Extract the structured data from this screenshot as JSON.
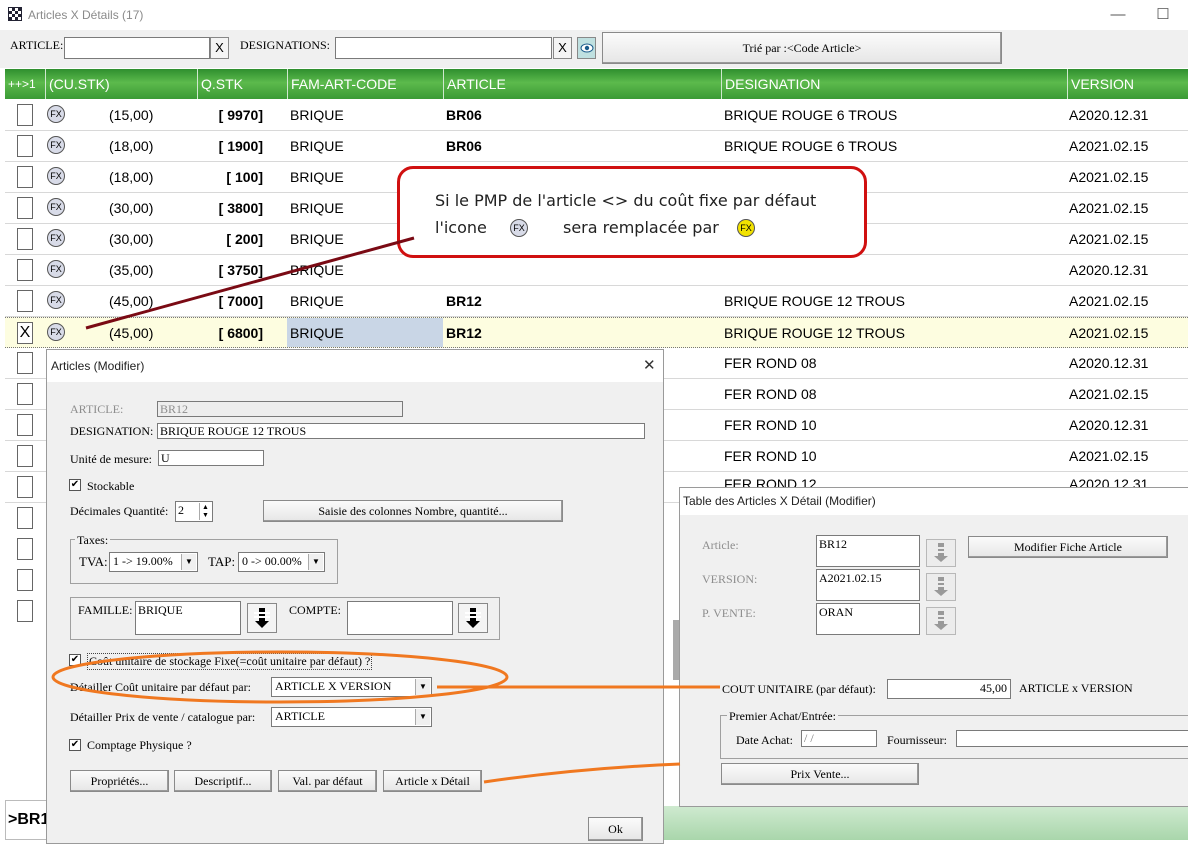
{
  "window": {
    "title": "Articles X Détails (17)",
    "minimize": "—",
    "maximize": "☐"
  },
  "toolbar": {
    "article_label": "ARTICLE:",
    "article_value": "",
    "designations_label": "DESIGNATIONS:",
    "designations_value": "",
    "clear_label": "X",
    "sort_label": "Trié par :<Code Article>"
  },
  "grid": {
    "columns": [
      "++>1",
      "(CU.STK)",
      "Q.STK",
      "FAM-ART-CODE",
      "ARTICLE",
      "DESIGNATION",
      "VERSION"
    ],
    "fx_label": "FX",
    "rows": [
      {
        "check": "",
        "cu": "(15,00)",
        "q": "[ 9970]",
        "fam": "BRIQUE",
        "article": "BR06",
        "designation": "BRIQUE ROUGE 6 TROUS",
        "version": "A2020.12.31"
      },
      {
        "check": "",
        "cu": "(18,00)",
        "q": "[ 1900]",
        "fam": "BRIQUE",
        "article": "BR06",
        "designation": "BRIQUE ROUGE 6 TROUS",
        "version": "A2021.02.15"
      },
      {
        "check": "",
        "cu": "(18,00)",
        "q": "[ 100]",
        "fam": "BRIQUE",
        "article": "",
        "designation": "",
        "version": "A2021.02.15"
      },
      {
        "check": "",
        "cu": "(30,00)",
        "q": "[ 3800]",
        "fam": "BRIQUE",
        "article": "",
        "designation": "",
        "version": "A2021.02.15"
      },
      {
        "check": "",
        "cu": "(30,00)",
        "q": "[ 200]",
        "fam": "BRIQUE",
        "article": "",
        "designation": "",
        "version": "A2021.02.15"
      },
      {
        "check": "",
        "cu": "(35,00)",
        "q": "[ 3750]",
        "fam": "BRIQUE",
        "article": "",
        "designation": "",
        "version": "A2020.12.31"
      },
      {
        "check": "",
        "cu": "(45,00)",
        "q": "[ 7000]",
        "fam": "BRIQUE",
        "article": "BR12",
        "designation": "BRIQUE ROUGE 12 TROUS",
        "version": "A2021.02.15"
      },
      {
        "check": "X",
        "cu": "(45,00)",
        "q": "[ 6800]",
        "fam": "BRIQUE",
        "article": "BR12",
        "designation": "BRIQUE ROUGE 12 TROUS",
        "version": "A2021.02.15"
      },
      {
        "check": "",
        "cu": "",
        "q": "",
        "fam": "",
        "article": "",
        "designation": "FER ROND 08",
        "version": "A2020.12.31"
      },
      {
        "check": "",
        "cu": "",
        "q": "",
        "fam": "",
        "article": "",
        "designation": "FER ROND 08",
        "version": "A2021.02.15"
      },
      {
        "check": "",
        "cu": "",
        "q": "",
        "fam": "",
        "article": "",
        "designation": "FER ROND 10",
        "version": "A2020.12.31"
      },
      {
        "check": "",
        "cu": "",
        "q": "",
        "fam": "",
        "article": "",
        "designation": "FER ROND 10",
        "version": "A2021.02.15"
      }
    ],
    "status_text": ">BR1"
  },
  "callout": {
    "line1": "Si le PMP de l'article <> du coût fixe par défaut",
    "line2_a": "l'icone",
    "line2_b": "sera remplacée par",
    "icon_label": "FX",
    "highlight_color": "#f2e200",
    "border_color": "#d01010"
  },
  "articles_dialog": {
    "title": "Articles  (Modifier)",
    "close": "✕",
    "article_label": "ARTICLE:",
    "article_value": "BR12",
    "designation_label": "DESIGNATION:",
    "designation_value": "BRIQUE ROUGE 12 TROUS",
    "unite_label": "Unité de mesure:",
    "unite_value": "U",
    "stockable_label": "Stockable",
    "decimales_label": "Décimales Quantité:",
    "decimales_value": "2",
    "saisie_button": "Saisie des colonnes Nombre, quantité...",
    "taxes_label": "Taxes:",
    "tva_label": "TVA:",
    "tva_value": "1 -> 19.00%",
    "tap_label": "TAP:",
    "tap_value": "0 -> 00.00%",
    "famille_label": "FAMILLE:",
    "famille_value": "BRIQUE",
    "compte_label": "COMPTE:",
    "compte_value": "",
    "cout_label": "Coût unitaire de stockage Fixe(=coût unitaire par défaut) ?",
    "detailler_cout_label": "Détailler Coût unitaire par défaut par:",
    "detailler_cout_value": "ARTICLE X VERSION",
    "detailler_prix_label": "Détailler Prix de vente / catalogue par:",
    "detailler_prix_value": "ARTICLE",
    "comptage_label": "Comptage Physique ?",
    "btn_proprietes": "Propriétés...",
    "btn_descriptif": "Descriptif...",
    "btn_val_defaut": "Val. par défaut",
    "btn_article_detail": "Article x Détail",
    "btn_ok": "Ok",
    "check_mark": "✔"
  },
  "table_dialog": {
    "title": "Table des Articles X Détail (Modifier)",
    "article_label": "Article:",
    "article_value": "BR12",
    "version_label": "VERSION:",
    "version_value": "A2021.02.15",
    "pvente_label": "P. VENTE:",
    "pvente_value": "ORAN",
    "modifier_fiche": "Modifier Fiche Article",
    "cout_label": "COUT UNITAIRE (par défaut):",
    "cout_value": "45,00",
    "cout_suffix": "ARTICLE x VERSION",
    "premier_achat": "Premier Achat/Entrée:",
    "date_label": "Date Achat:",
    "date_value": " / /",
    "fournisseur_label": "Fournisseur:",
    "fournisseur_value": "",
    "prix_vente_button": "Prix Vente...",
    "behind_text": "FER ROND 12",
    "behind_version": "A2020.12.31"
  },
  "colors": {
    "header_green": "#3a9a35",
    "annotation_orange": "#f07820",
    "selected_row": "#fdfde0"
  }
}
